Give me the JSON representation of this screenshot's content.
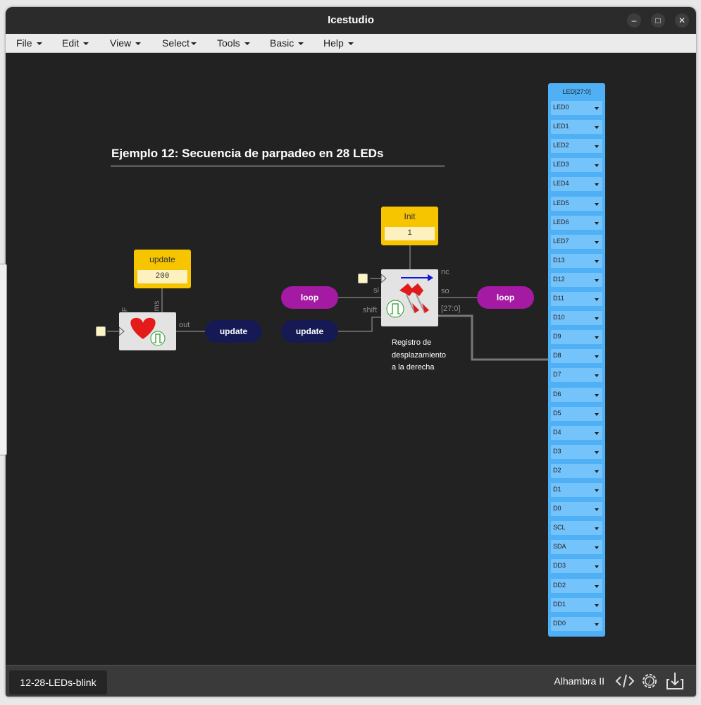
{
  "window": {
    "title": "Icestudio"
  },
  "menu": [
    {
      "label": "File"
    },
    {
      "label": "Edit"
    },
    {
      "label": "View"
    },
    {
      "label": "Select"
    },
    {
      "label": "Tools"
    },
    {
      "label": "Basic"
    },
    {
      "label": "Help"
    }
  ],
  "canvas": {
    "label": "Ejemplo 12: Secuencia de parpadeo en 28 LEDs",
    "const_update": {
      "name": "update",
      "value": "200"
    },
    "const_init": {
      "name": "Init",
      "value": "1"
    },
    "heart_block": {
      "ports": {
        "f": "F",
        "ms": "ms",
        "out": "out"
      }
    },
    "pills": {
      "update_out": "update",
      "loop_in": "loop",
      "update_in": "update",
      "loop_out": "loop"
    },
    "shift_block": {
      "ports": {
        "si": "si",
        "shift": "shift",
        "nc": "nc",
        "so": "so",
        "bus": "[27:0]"
      },
      "note_lines": [
        "Registro de",
        "desplazamiento",
        "a la derecha"
      ]
    },
    "led_panel": {
      "title": "LED[27:0]",
      "pins": [
        "LED0",
        "LED1",
        "LED2",
        "LED3",
        "LED4",
        "LED5",
        "LED6",
        "LED7",
        "D13",
        "D12",
        "D11",
        "D10",
        "D9",
        "D8",
        "D7",
        "D6",
        "D5",
        "D4",
        "D3",
        "D2",
        "D1",
        "D0",
        "SCL",
        "SDA",
        "DD3",
        "DD2",
        "DD1",
        "DD0"
      ]
    }
  },
  "footer": {
    "tab": "12-28-LEDs-blink",
    "board": "Alhambra II"
  },
  "icons": {
    "code": "code-icon",
    "settings": "gear-code-icon",
    "download": "download-icon",
    "heart": "heart-icon",
    "arrow": "right-arrow-icon",
    "pins": "pushpin-icon",
    "pulse": "clock-pulse-icon"
  },
  "colors": {
    "canvas": "#222222",
    "constant": "#f7c400",
    "loop_label": "#a51aa3",
    "update_label": "#151a55",
    "led_panel": "#4fb0f6",
    "wire": "#777777"
  }
}
